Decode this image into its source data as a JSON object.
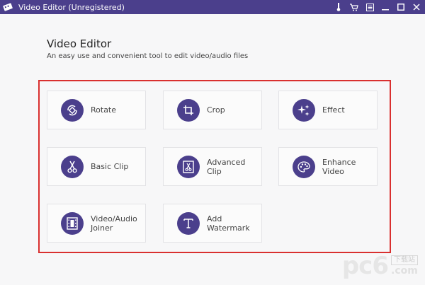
{
  "window": {
    "title": "Video Editor (Unregistered)",
    "controls": [
      "thermometer-icon",
      "cart-icon",
      "menu-icon",
      "minimize-icon",
      "maximize-icon",
      "close-icon"
    ]
  },
  "main": {
    "heading": "Video Editor",
    "subheading": "An easy use and convenient tool to edit video/audio files"
  },
  "tools": [
    {
      "label": "Rotate",
      "icon": "rotate-icon"
    },
    {
      "label": "Crop",
      "icon": "crop-icon"
    },
    {
      "label": "Effect",
      "icon": "effect-icon"
    },
    {
      "label": "Basic Clip",
      "icon": "scissors-icon"
    },
    {
      "label": "Advanced Clip",
      "icon": "advanced-clip-icon"
    },
    {
      "label": "Enhance Video",
      "icon": "palette-icon"
    },
    {
      "label": "Video/Audio Joiner",
      "icon": "film-icon"
    },
    {
      "label": "Add Watermark",
      "icon": "text-t-icon"
    }
  ],
  "watermark": {
    "big": "pc6",
    "small_top": "下载站",
    "small_bottom": ".com"
  },
  "colors": {
    "accent": "#4b3f8c",
    "highlight_border": "#d9302f"
  }
}
